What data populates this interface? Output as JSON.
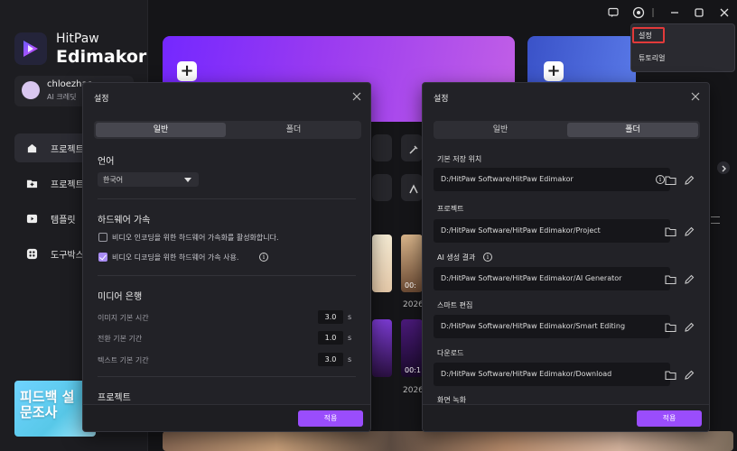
{
  "app": {
    "brand_line1": "HitPaw",
    "brand_line2": "Edimakor"
  },
  "user": {
    "name": "chloezhao",
    "plan": "AI 크레딧"
  },
  "sidebar": {
    "items": [
      {
        "label": "프로젝트",
        "icon": "home-icon"
      },
      {
        "label": "프로젝트",
        "icon": "folder-add-icon"
      },
      {
        "label": "템플릿",
        "icon": "template-icon"
      },
      {
        "label": "도구박스",
        "icon": "toolbox-icon"
      }
    ],
    "promo": {
      "line1": "피드백 설",
      "line2": "문조사"
    }
  },
  "titlebar": {
    "icons": [
      "feedback-icon",
      "settings-gear-icon",
      "minimize-icon",
      "maximize-icon",
      "close-icon"
    ]
  },
  "dropdown": {
    "items": [
      "설정",
      "튜토리얼"
    ]
  },
  "background": {
    "dates": [
      "2026-",
      "2026-"
    ],
    "times": [
      "00:",
      "00:1"
    ]
  },
  "dialog_general": {
    "title": "설정",
    "tabs": [
      "일반",
      "폴더"
    ],
    "active_tab": "일반",
    "language": {
      "heading": "언어",
      "value": "한국어"
    },
    "hardware": {
      "heading": "하드웨어 가속",
      "options": [
        {
          "label": "비디오 인코딩을 위한 하드웨어 가속화를 활성화합니다.",
          "checked": false
        },
        {
          "label": "비디오 디코딩을 위한 하드웨어 가속 사용.",
          "checked": true
        }
      ]
    },
    "media": {
      "heading": "미디어 은행",
      "rows": [
        {
          "label": "이미지 기본 시간",
          "value": "3.0",
          "unit": "s"
        },
        {
          "label": "전환 기본 기간",
          "value": "1.0",
          "unit": "s"
        },
        {
          "label": "텍스트 기본 기간",
          "value": "3.0",
          "unit": "s"
        }
      ]
    },
    "project_heading": "프로젝트",
    "apply_label": "적용"
  },
  "dialog_folder": {
    "title": "설정",
    "tabs": [
      "일반",
      "폴더"
    ],
    "active_tab": "폴더",
    "folders": [
      {
        "label": "기본 저장 위치",
        "path": "D:/HitPaw Software/HitPaw Edimakor"
      },
      {
        "label": "프로젝트",
        "path": "D:/HitPaw Software/HitPaw Edimakor/Project"
      },
      {
        "label": "AI 생성 결과",
        "path": "D:/HitPaw Software/HitPaw Edimakor/AI Generator"
      },
      {
        "label": "스마트 편집",
        "path": "D:/HitPaw Software/HitPaw Edimakor/Smart Editing"
      },
      {
        "label": "다운로드",
        "path": "D:/HitPaw Software/HitPaw Edimakor/Download"
      }
    ],
    "partial_label": "화면 녹화",
    "apply_label": "적용"
  },
  "colors": {
    "accent": "#9a4dfc",
    "highlight_box": "#e23a3a"
  }
}
